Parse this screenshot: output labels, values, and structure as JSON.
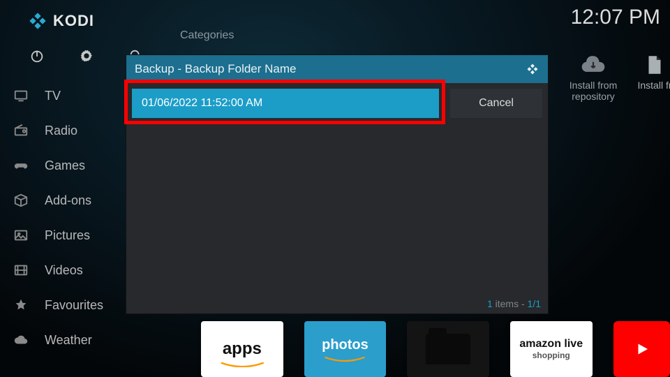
{
  "header": {
    "app_name": "KODI",
    "clock": "12:07 PM"
  },
  "top_icons": [
    "power-icon",
    "gear-icon",
    "search-icon"
  ],
  "sidebar": {
    "items": [
      {
        "label": "TV",
        "icon": "tv-icon"
      },
      {
        "label": "Radio",
        "icon": "radio-icon"
      },
      {
        "label": "Games",
        "icon": "gamepad-icon"
      },
      {
        "label": "Add-ons",
        "icon": "box-icon"
      },
      {
        "label": "Pictures",
        "icon": "image-icon"
      },
      {
        "label": "Videos",
        "icon": "film-icon"
      },
      {
        "label": "Favourites",
        "icon": "star-icon"
      },
      {
        "label": "Weather",
        "icon": "cloud-icon"
      }
    ]
  },
  "main": {
    "categories_label": "Categories",
    "install_from_repository": "Install from repository",
    "install_from": "Install fr"
  },
  "apps": {
    "apps": "apps",
    "photos": "photos",
    "amazon_l1": "amazon live",
    "amazon_l2": "shopping"
  },
  "dialog": {
    "title": "Backup - Backup Folder Name",
    "item": "01/06/2022 11:52:00 AM",
    "cancel": "Cancel",
    "footer_count": "1",
    "footer_items": "items",
    "footer_page": "1/1"
  }
}
